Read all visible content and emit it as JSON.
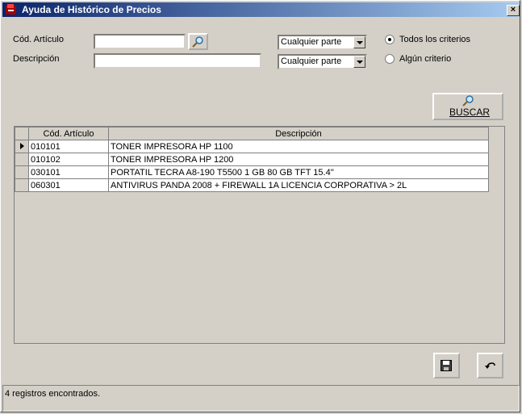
{
  "window": {
    "title": "Ayuda de Histórico de Precios",
    "close": "×"
  },
  "form": {
    "cod_label": "Cód. Artículo",
    "desc_label": "Descripción",
    "cod_value": "",
    "desc_value": "",
    "cod_match": "Cualquier parte",
    "desc_match": "Cualquier parte",
    "radio_all": "Todos los criterios",
    "radio_any": "Algún criterio",
    "search_button": "BUSCAR"
  },
  "grid": {
    "headers": [
      "Cód. Artículo",
      "Descripción"
    ],
    "rows": [
      {
        "code": "010101",
        "desc": "TONER IMPRESORA HP 1100"
      },
      {
        "code": "010102",
        "desc": "TONER IMPRESORA HP 1200"
      },
      {
        "code": "030101",
        "desc": "PORTATIL TECRA A8-190 T5500 1 GB 80 GB TFT 15.4''"
      },
      {
        "code": "060301",
        "desc": "ANTIVIRUS PANDA 2008 + FIREWALL 1A LICENCIA CORPORATIVA > 2L"
      }
    ]
  },
  "status": {
    "text": "4 registros encontrados."
  },
  "colors": {
    "titlebar_start": "#0a246a",
    "titlebar_end": "#a6caf0",
    "face": "#d4d0c8"
  }
}
